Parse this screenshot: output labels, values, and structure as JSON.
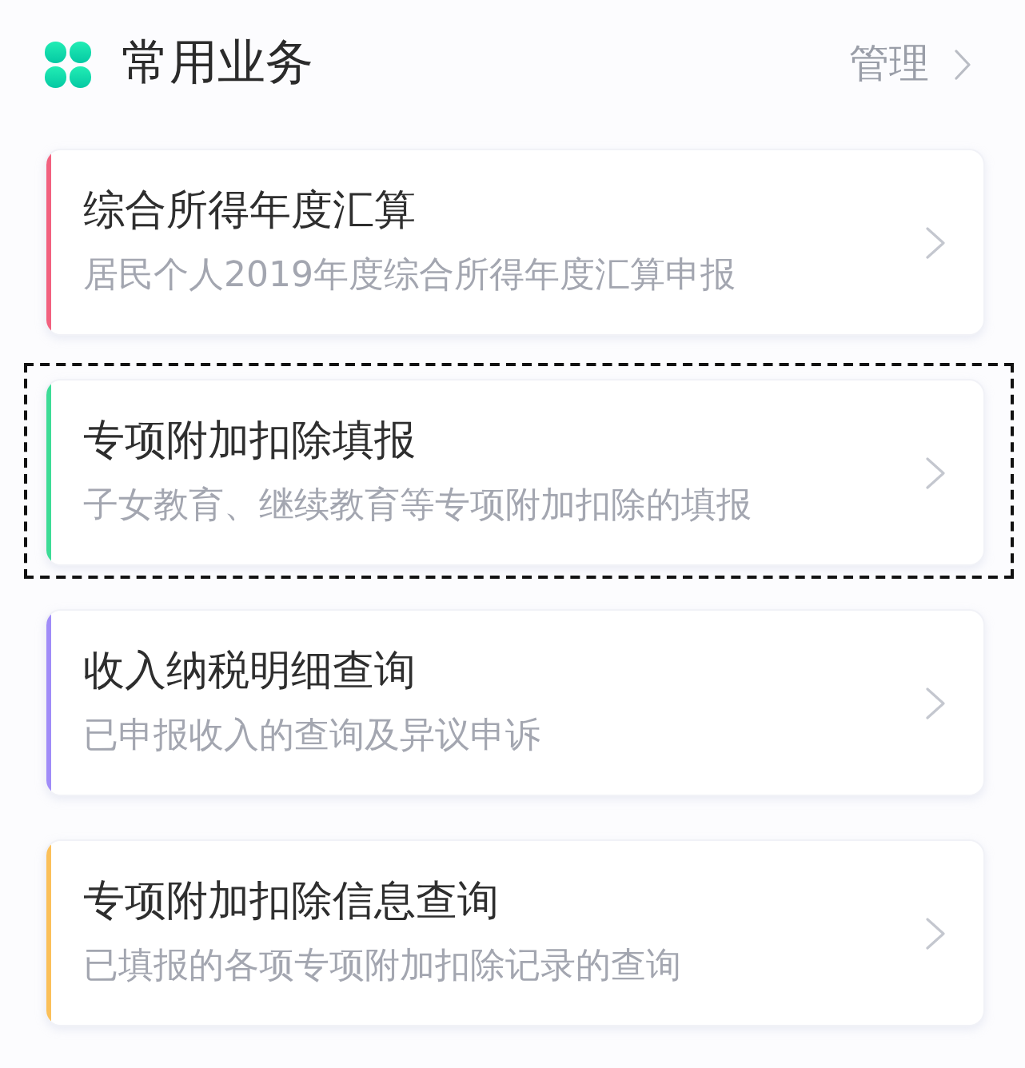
{
  "header": {
    "title": "常用业务",
    "action": "管理"
  },
  "cards": [
    {
      "title": "综合所得年度汇算",
      "subtitle": "居民个人2019年度综合所得年度汇算申报",
      "color": "#f2617f",
      "highlighted": false
    },
    {
      "title": "专项附加扣除填报",
      "subtitle": "子女教育、继续教育等专项附加扣除的填报",
      "color": "#3ddc97",
      "highlighted": true
    },
    {
      "title": "收入纳税明细查询",
      "subtitle": "已申报收入的查询及异议申诉",
      "color": "#a08cf8",
      "highlighted": false
    },
    {
      "title": "专项附加扣除信息查询",
      "subtitle": "已填报的各项专项附加扣除记录的查询",
      "color": "#fbc05a",
      "highlighted": false
    }
  ]
}
